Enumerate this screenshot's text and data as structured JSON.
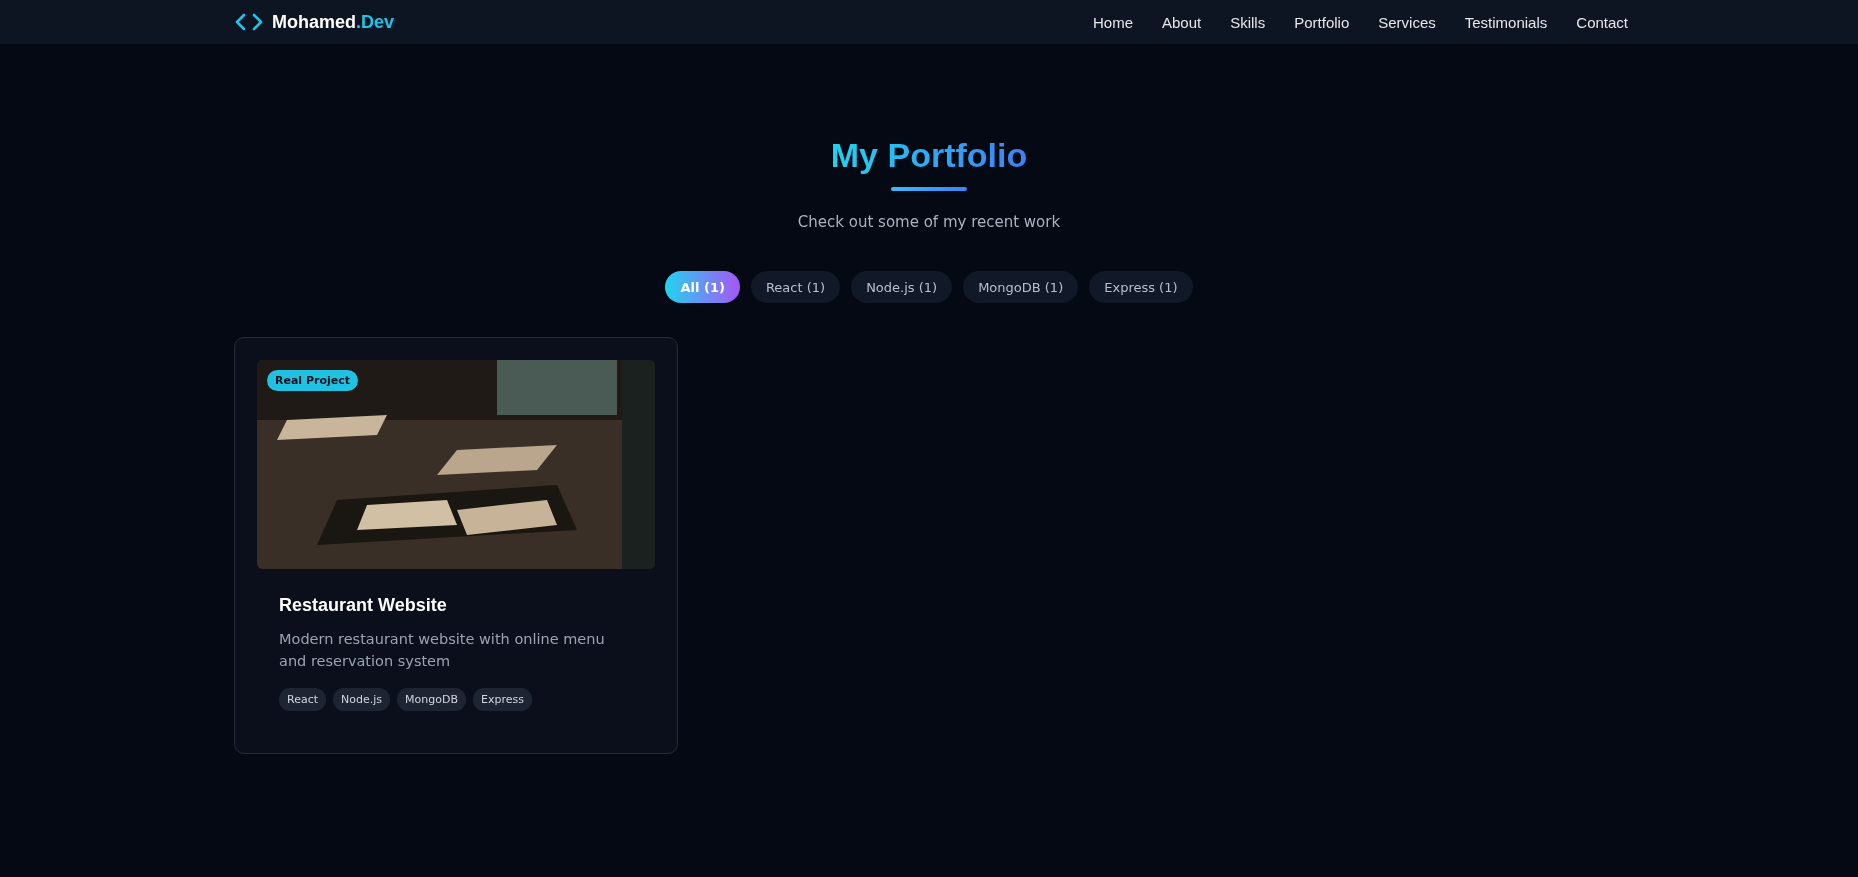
{
  "navbar": {
    "logo": {
      "name": "Mohamed",
      "suffix": ".Dev"
    },
    "links": [
      {
        "label": "Home"
      },
      {
        "label": "About"
      },
      {
        "label": "Skills"
      },
      {
        "label": "Portfolio"
      },
      {
        "label": "Services"
      },
      {
        "label": "Testimonials"
      },
      {
        "label": "Contact"
      }
    ]
  },
  "section": {
    "title": "My Portfolio",
    "subtitle": "Check out some of my recent work"
  },
  "filters": [
    {
      "label": "All (1)",
      "selected": true
    },
    {
      "label": "React (1)",
      "selected": false
    },
    {
      "label": "Node.js (1)",
      "selected": false
    },
    {
      "label": "MongoDB (1)",
      "selected": false
    },
    {
      "label": "Express (1)",
      "selected": false
    }
  ],
  "projects": [
    {
      "badge": "Real Project",
      "title": "Restaurant Website",
      "description": "Modern restaurant website with online menu and reservation system",
      "tags": [
        "React",
        "Node.js",
        "MongoDB",
        "Express"
      ]
    }
  ]
}
